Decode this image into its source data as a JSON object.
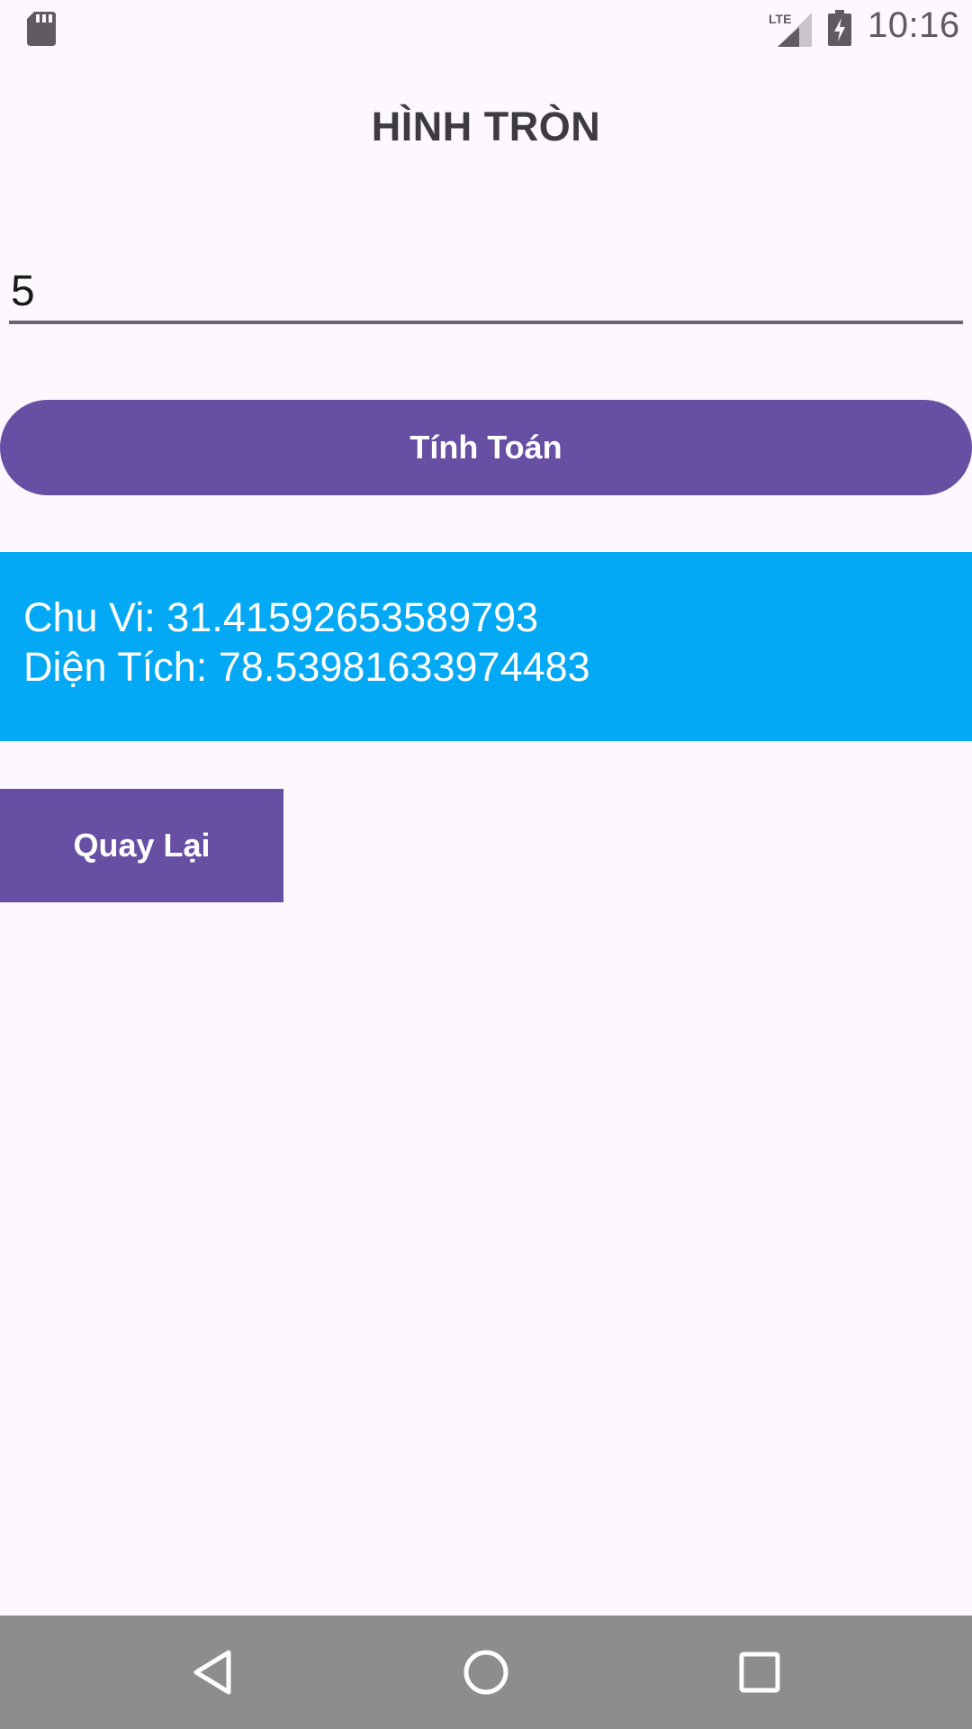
{
  "status_bar": {
    "time": "10:16",
    "network": "LTE",
    "icons": [
      "sd-card-icon",
      "lte-signal-icon",
      "battery-charging-icon"
    ]
  },
  "screen": {
    "title": "HÌNH TRÒN",
    "radius_input_value": "5",
    "calculate_button_label": "Tính Toán",
    "result": {
      "circumference_line": "Chu Vi: 31.41592653589793",
      "area_line": "Diện Tích: 78.53981633974483"
    },
    "back_button_label": "Quay Lại"
  },
  "nav_bar": {
    "icons": [
      "back-triangle-icon",
      "home-circle-icon",
      "recents-square-icon"
    ]
  },
  "colors": {
    "background": "#FDF7FE",
    "primary": "#6750A4",
    "result_background": "#03A9F4",
    "nav_bar": "#8F8C90",
    "title_text": "#3D3A40"
  }
}
